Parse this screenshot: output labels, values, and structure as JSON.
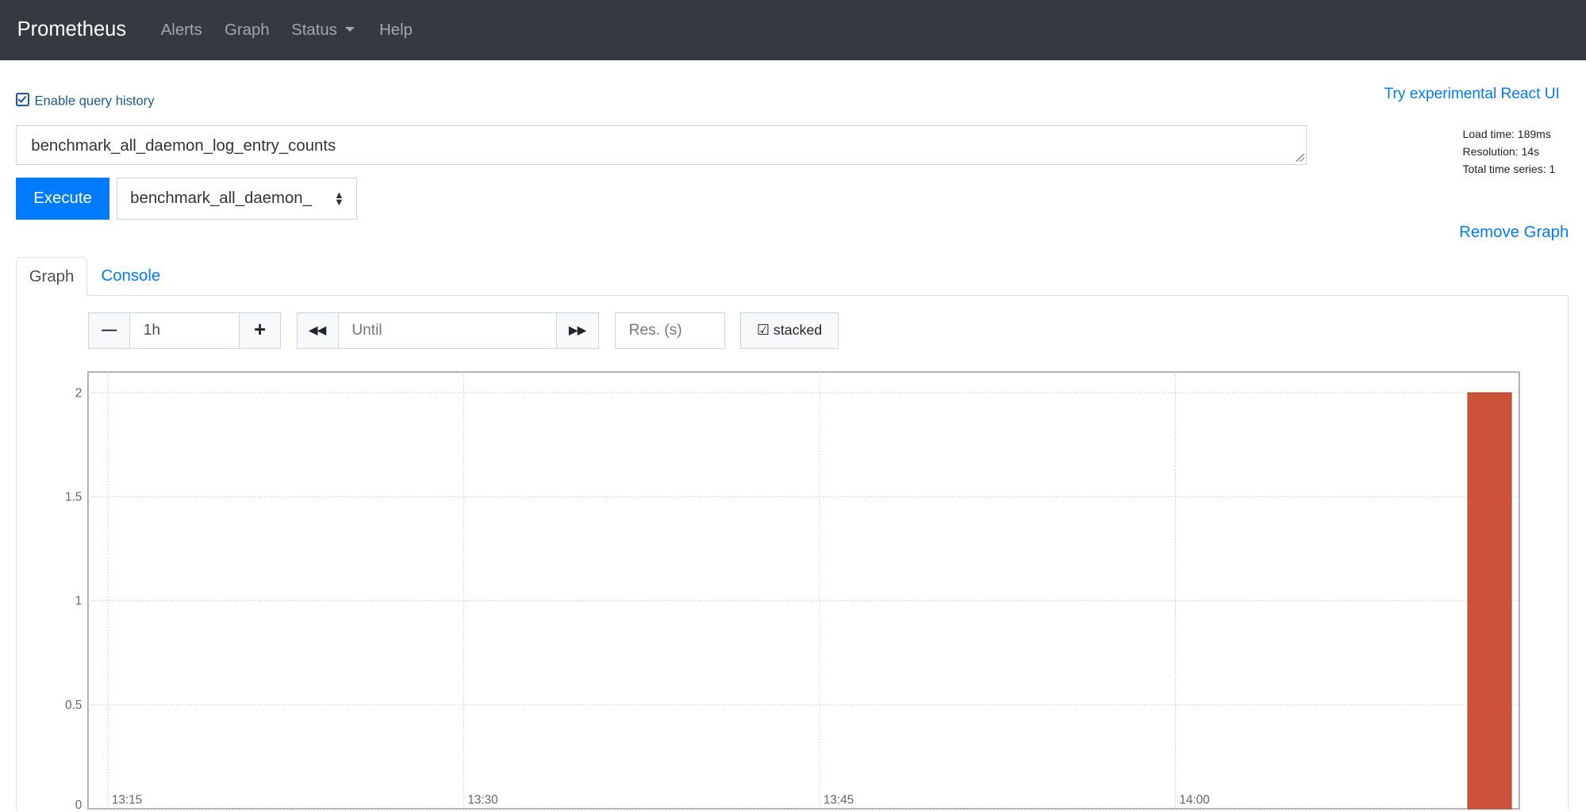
{
  "nav": {
    "brand": "Prometheus",
    "links": [
      "Alerts",
      "Graph",
      "Status",
      "Help"
    ]
  },
  "query_history_label": "Enable query history",
  "react_link": "Try experimental React UI",
  "expression": "benchmark_all_daemon_log_entry_counts",
  "stats": {
    "load_time": "Load time: 189ms",
    "resolution": "Resolution: 14s",
    "total_series": "Total time series: 1"
  },
  "execute_label": "Execute",
  "metric_select": "benchmark_all_daemon_",
  "remove_graph": "Remove Graph",
  "tabs": [
    "Graph",
    "Console"
  ],
  "controls": {
    "range": "1h",
    "until_placeholder": "Until",
    "res_placeholder": "Res. (s)",
    "stacked_label": "stacked"
  },
  "colors": {
    "nav_bg": "#343a40",
    "accent": "#007bff",
    "bar": "#cb513a"
  },
  "chart_data": {
    "type": "bar",
    "stacked": true,
    "grid": true,
    "x_ticks": [
      "13:15",
      "13:30",
      "13:45",
      "14:00"
    ],
    "x_range": [
      "13:14:10",
      "14:14:30"
    ],
    "y_ticks": [
      "0",
      "0.5",
      "1",
      "1.5",
      "2"
    ],
    "ylim": [
      0,
      2.1
    ],
    "series": [
      {
        "points": [
          {
            "start": "14:12:20",
            "end": "14:14:10",
            "value": 2
          }
        ]
      }
    ]
  }
}
